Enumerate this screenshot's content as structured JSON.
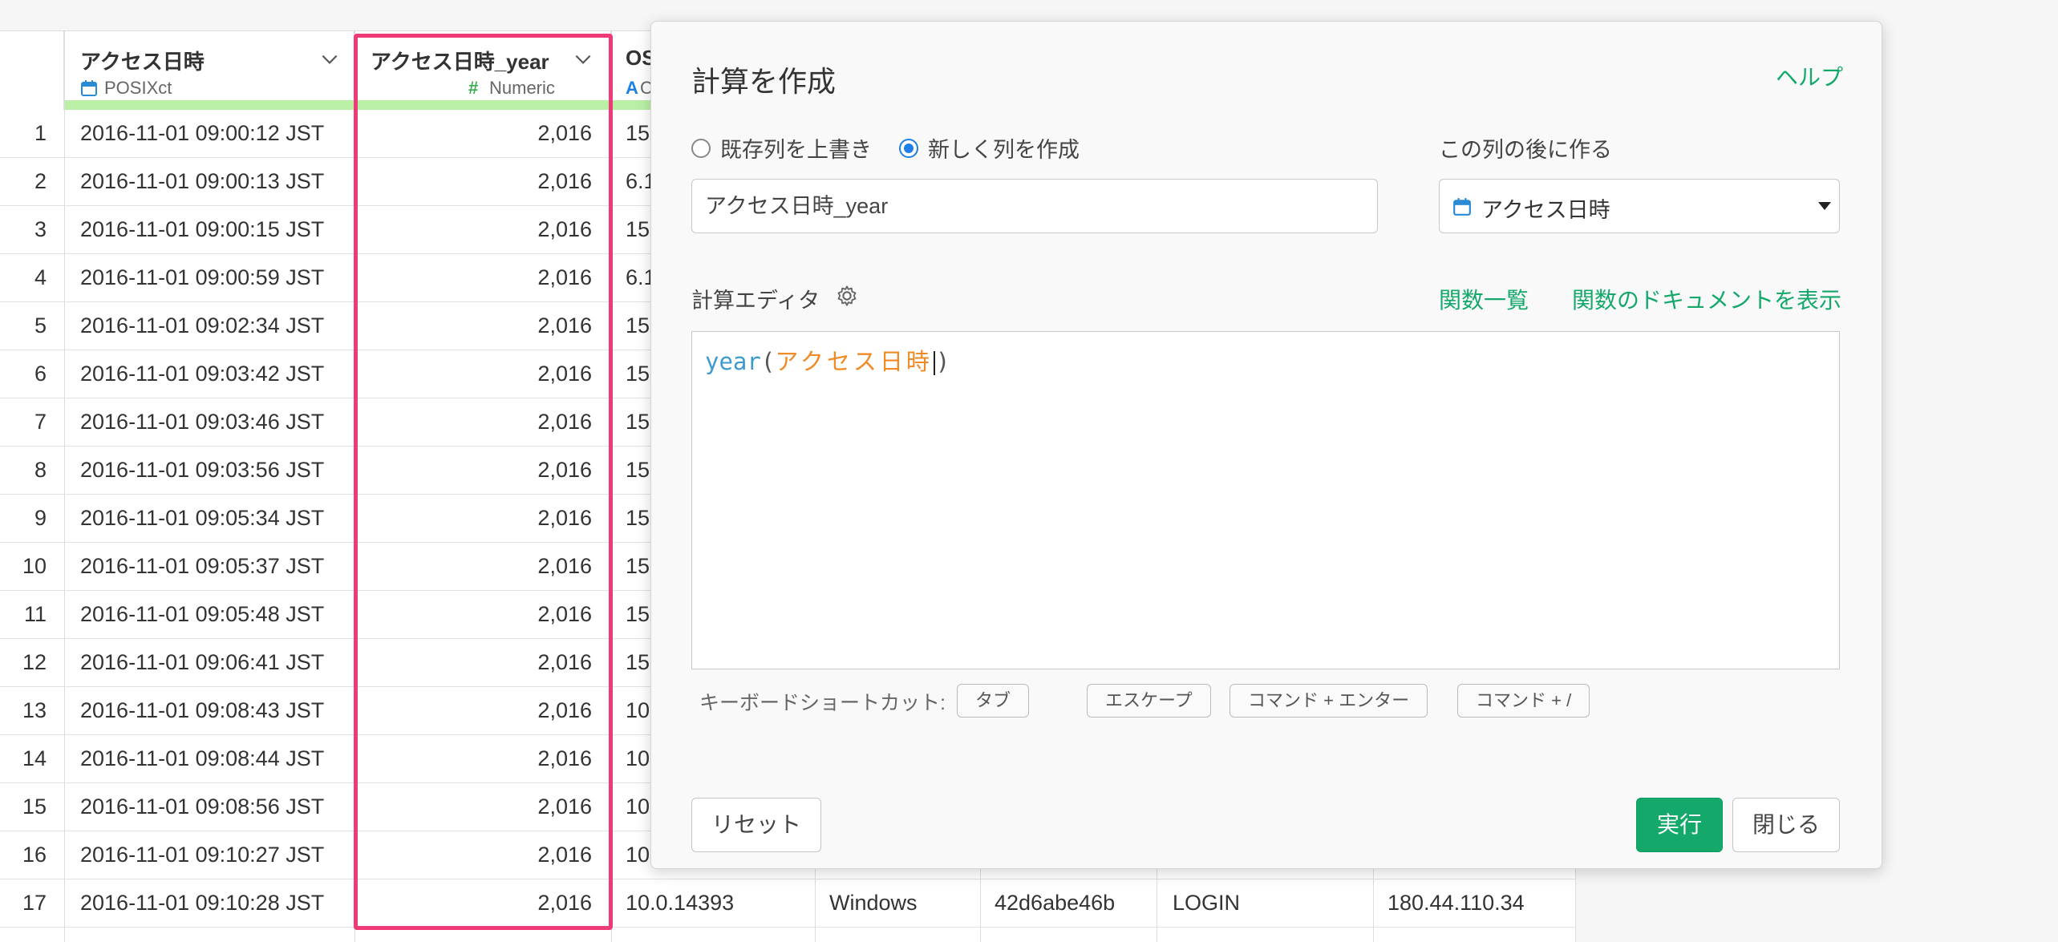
{
  "grid": {
    "columns": [
      {
        "name": "アクセス日時",
        "type": "POSIXct",
        "type_icon": "calendar-icon"
      },
      {
        "name": "アクセス日時_year",
        "type": "Numeric",
        "type_icon": "hash-icon"
      },
      {
        "name": "OS",
        "type": "C",
        "type_icon": "text-A-icon"
      }
    ],
    "rows": [
      {
        "n": "1",
        "datetime": "2016-11-01 09:00:12 JST",
        "year": "2,016",
        "os": "15"
      },
      {
        "n": "2",
        "datetime": "2016-11-01 09:00:13 JST",
        "year": "2,016",
        "os": "6.1"
      },
      {
        "n": "3",
        "datetime": "2016-11-01 09:00:15 JST",
        "year": "2,016",
        "os": "15"
      },
      {
        "n": "4",
        "datetime": "2016-11-01 09:00:59 JST",
        "year": "2,016",
        "os": "6.1"
      },
      {
        "n": "5",
        "datetime": "2016-11-01 09:02:34 JST",
        "year": "2,016",
        "os": "15"
      },
      {
        "n": "6",
        "datetime": "2016-11-01 09:03:42 JST",
        "year": "2,016",
        "os": "15"
      },
      {
        "n": "7",
        "datetime": "2016-11-01 09:03:46 JST",
        "year": "2,016",
        "os": "15"
      },
      {
        "n": "8",
        "datetime": "2016-11-01 09:03:56 JST",
        "year": "2,016",
        "os": "15"
      },
      {
        "n": "9",
        "datetime": "2016-11-01 09:05:34 JST",
        "year": "2,016",
        "os": "15"
      },
      {
        "n": "10",
        "datetime": "2016-11-01 09:05:37 JST",
        "year": "2,016",
        "os": "15"
      },
      {
        "n": "11",
        "datetime": "2016-11-01 09:05:48 JST",
        "year": "2,016",
        "os": "15"
      },
      {
        "n": "12",
        "datetime": "2016-11-01 09:06:41 JST",
        "year": "2,016",
        "os": "15"
      },
      {
        "n": "13",
        "datetime": "2016-11-01 09:08:43 JST",
        "year": "2,016",
        "os": "10"
      },
      {
        "n": "14",
        "datetime": "2016-11-01 09:08:44 JST",
        "year": "2,016",
        "os": "10"
      },
      {
        "n": "15",
        "datetime": "2016-11-01 09:08:56 JST",
        "year": "2,016",
        "os": "10"
      },
      {
        "n": "16",
        "datetime": "2016-11-01 09:10:27 JST",
        "year": "2,016",
        "os": "10"
      },
      {
        "n": "17",
        "datetime": "2016-11-01 09:10:28 JST",
        "year": "2,016",
        "os": "10.0.14393",
        "platform": "Windows",
        "id": "42d6abe46b",
        "event": "LOGIN",
        "ip": "180.44.110.34"
      }
    ]
  },
  "dialog": {
    "title": "計算を作成",
    "help_link": "ヘルプ",
    "radio_overwrite": "既存列を上書き",
    "radio_new": "新しく列を作成",
    "selected_mode": "new",
    "column_name_value": "アクセス日時_year",
    "insert_after_label": "この列の後に作る",
    "insert_after_value": "アクセス日時",
    "editor_label": "計算エディタ",
    "function_list_link": "関数一覧",
    "function_doc_link": "関数のドキュメントを表示",
    "code_fn": "year",
    "code_open": "(",
    "code_arg": "アクセス日時",
    "code_close": ")",
    "shortcut_label": "キーボードショートカット:",
    "shortcuts": [
      "タブ",
      "エスケープ",
      "コマンド + エンター",
      "コマンド + /"
    ],
    "reset_button": "リセット",
    "run_button": "実行",
    "close_button": "閉じる"
  },
  "colors": {
    "accent_green": "#14a86b",
    "highlight_pink": "#ef3a79",
    "header_bar": "#b9f0a6",
    "radio_blue": "#1e7fe6",
    "code_function": "#3d9ad1",
    "code_column": "#f08a24"
  }
}
